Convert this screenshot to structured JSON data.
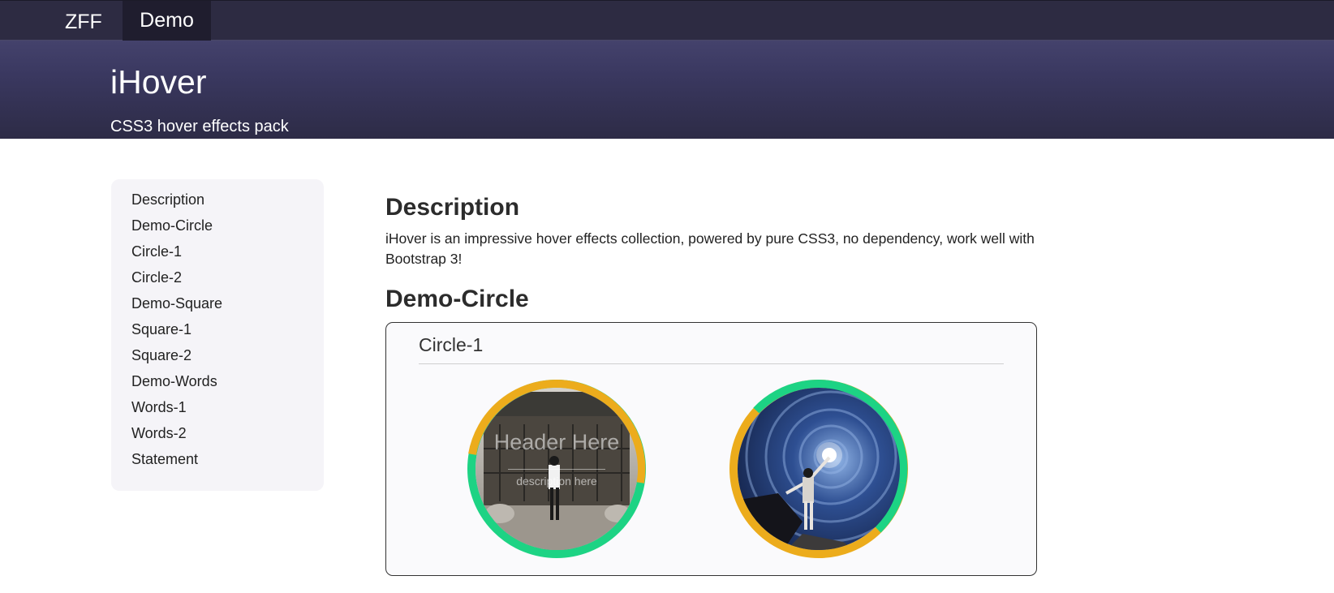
{
  "navbar": {
    "brand": "ZFF",
    "active_tab": "Demo"
  },
  "hero": {
    "title": "iHover",
    "subtitle": "CSS3 hover effects pack"
  },
  "sidebar": {
    "items": [
      {
        "label": "Description"
      },
      {
        "label": "Demo-Circle"
      },
      {
        "label": "Circle-1"
      },
      {
        "label": "Circle-2"
      },
      {
        "label": "Demo-Square"
      },
      {
        "label": "Square-1"
      },
      {
        "label": "Square-2"
      },
      {
        "label": "Demo-Words"
      },
      {
        "label": "Words-1"
      },
      {
        "label": "Words-2"
      },
      {
        "label": "Statement"
      }
    ]
  },
  "main": {
    "description": {
      "title": "Description",
      "text": "iHover is an impressive hover effects collection, powered by pure CSS3, no dependency, work well with Bootstrap 3!"
    },
    "demo_circle": {
      "title": "Demo-Circle",
      "subtitle": "Circle-1",
      "items": [
        {
          "header": "Header Here",
          "description": "description here",
          "image_desc": "person walking past traditional wooden building"
        },
        {
          "header": "",
          "description": "",
          "image_desc": "person reaching toward starry swirl sky"
        }
      ]
    }
  },
  "colors": {
    "nav_bg": "#2d2b42",
    "hero_top": "#44426c",
    "hero_bottom": "#2d2b46",
    "ring_orange": "#ecac1c",
    "ring_green": "#1dd384",
    "sidebar_bg": "#f5f4f8"
  }
}
